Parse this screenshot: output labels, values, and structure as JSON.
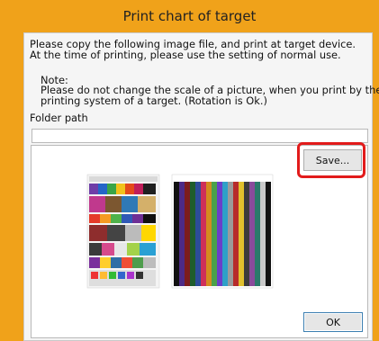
{
  "window": {
    "title": "Print chart of target",
    "accent_color": "#f0a21a"
  },
  "dialog": {
    "instruction_line1": "Please copy the following image file, and print at target device.",
    "instruction_line2": "At the time of printing, please use the setting of normal use.",
    "note_label": "Note:",
    "note_line1": "Please do not change the scale of a picture, when you print by the",
    "note_line2": "printing system of a target. (Rotation is Ok.)",
    "folder_path_label": "Folder path",
    "folder_path_value": "",
    "save_label": "Save...",
    "ok_label": "OK",
    "highlight_color": "#e21b1b"
  }
}
